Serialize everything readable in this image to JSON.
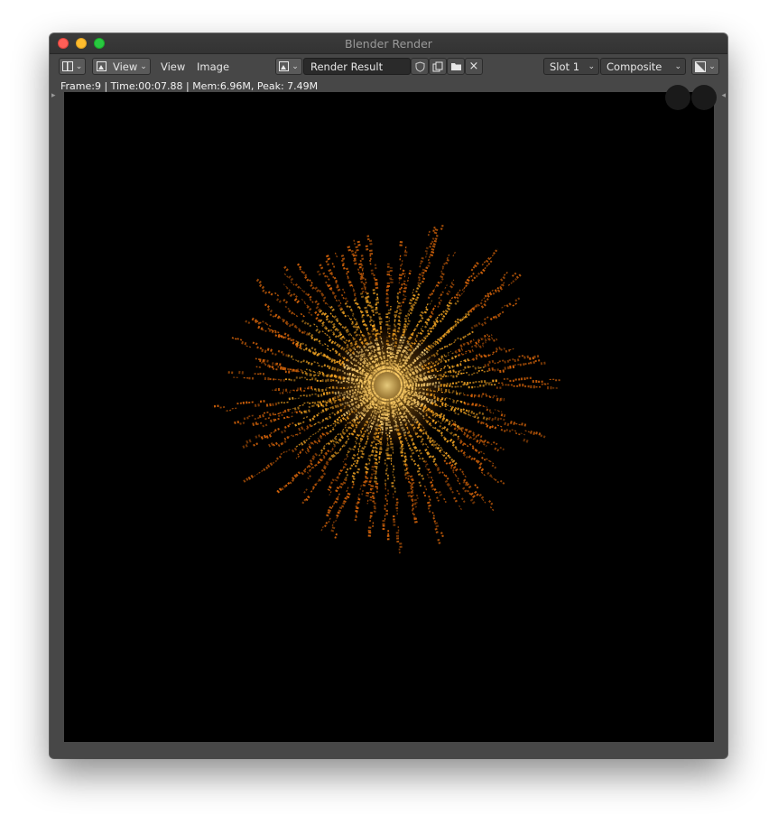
{
  "window": {
    "title": "Blender Render"
  },
  "toolbar": {
    "editor_type_icon": "image-editor-icon",
    "view_menu_icon": "image-icon",
    "view_dropdown_label": "View",
    "view_menu": "View",
    "image_menu": "Image",
    "browse_image_icon": "image-browse-icon",
    "image_name": "Render Result",
    "fake_user_icon": "shield-icon",
    "new_image_icon": "new-document-icon",
    "open_image_icon": "folder-icon",
    "unlink_icon": "close-icon",
    "slot_label": "Slot 1",
    "layer_label": "Composite",
    "display_channels_icon": "display-channels-icon"
  },
  "info": {
    "text": "Frame:9 | Time:00:07.88 | Mem:6.96M, Peak: 7.49M"
  },
  "render": {
    "subject": "orange particle burst",
    "colors": {
      "core": "#ffe08a",
      "mid": "#f5a623",
      "outer": "#d8650a",
      "background": "#000000"
    }
  }
}
